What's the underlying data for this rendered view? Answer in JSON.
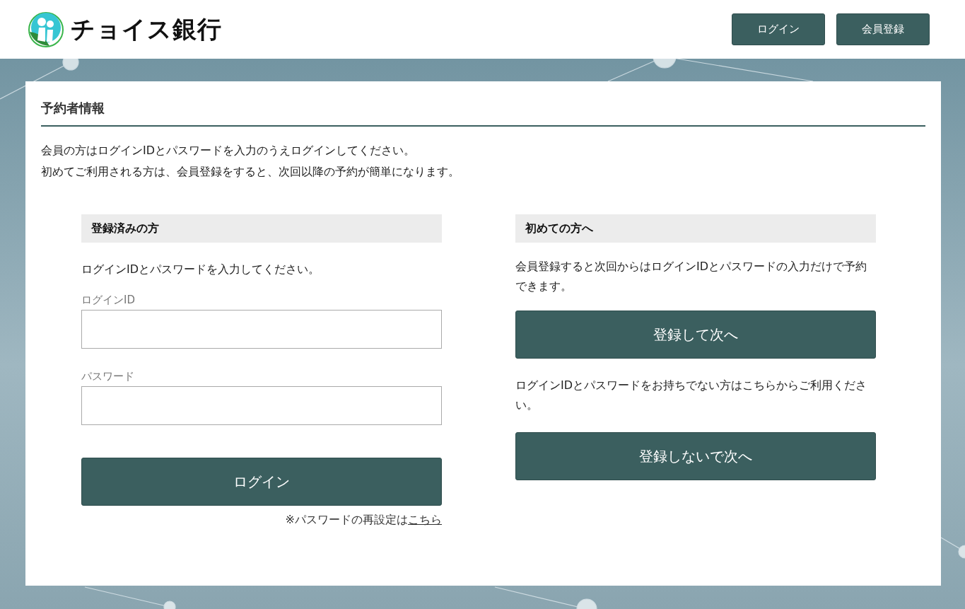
{
  "header": {
    "brand": "チョイス銀行",
    "buttons": [
      "ログイン",
      "会員登録"
    ]
  },
  "card": {
    "title": "予約者情報",
    "intro": [
      "会員の方はログインIDとパスワードを入力のうえログインしてください。",
      "初めてご利用される方は、会員登録をすると、次回以降の予約が簡単になります。"
    ],
    "registered": {
      "heading": "登録済みの方",
      "description": "ログインIDとパスワードを入力してください。",
      "fields": [
        {
          "label": "ログインID"
        },
        {
          "label": "パスワード"
        }
      ],
      "button": "ログイン",
      "reset_note": {
        "text": "※パスワードの再設定は",
        "link": "こちら"
      }
    },
    "first_time": {
      "heading": "初めての方へ",
      "sections": [
        {
          "description": "会員登録すると次回からはログインIDとパスワードの入力だけで予約できます。",
          "button": "登録して次へ"
        },
        {
          "description": "ログインIDとパスワードをお持ちでない方はこちらからご利用ください。",
          "button": "登録しないで次へ"
        }
      ]
    }
  }
}
